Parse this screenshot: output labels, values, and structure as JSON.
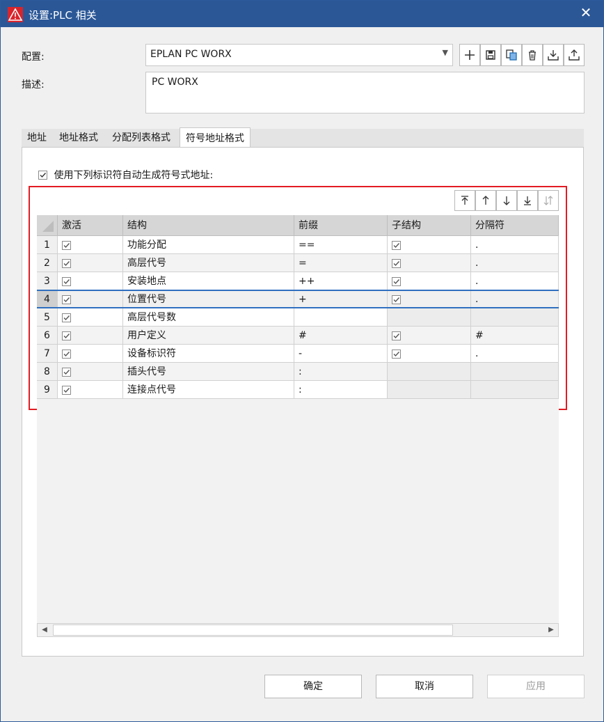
{
  "window": {
    "title": "设置:PLC 相关",
    "close_glyph": "✕"
  },
  "form": {
    "config_label": "配置:",
    "config_value": "EPLAN PC WORX",
    "desc_label": "描述:",
    "desc_value": "PC WORX"
  },
  "tabs": [
    {
      "label": "地址"
    },
    {
      "label": "地址格式"
    },
    {
      "label": "分配列表格式"
    },
    {
      "label": "符号地址格式",
      "active": true
    }
  ],
  "autogen_label": "使用下列标识符自动生成符号式地址:",
  "columns": [
    "激活",
    "结构",
    "前缀",
    "子结构",
    "分隔符"
  ],
  "rows": [
    {
      "num": "1",
      "active": true,
      "structure": "功能分配",
      "prefix": "==",
      "sub": true,
      "sep": "."
    },
    {
      "num": "2",
      "active": true,
      "structure": "高层代号",
      "prefix": "=",
      "sub": true,
      "sep": "."
    },
    {
      "num": "3",
      "active": true,
      "structure": "安装地点",
      "prefix": "++",
      "sub": true,
      "sep": "."
    },
    {
      "num": "4",
      "active": true,
      "structure": "位置代号",
      "prefix": "+",
      "sub": true,
      "sep": ".",
      "selected": true
    },
    {
      "num": "5",
      "active": true,
      "structure": "高层代号数",
      "prefix": "",
      "sub": false,
      "sep": ""
    },
    {
      "num": "6",
      "active": true,
      "structure": "用户定义",
      "prefix": "#",
      "sub": true,
      "sep": "#"
    },
    {
      "num": "7",
      "active": true,
      "structure": "设备标识符",
      "prefix": "-",
      "sub": true,
      "sep": "."
    },
    {
      "num": "8",
      "active": true,
      "structure": "插头代号",
      "prefix": ":",
      "sub": false,
      "sep": ""
    },
    {
      "num": "9",
      "active": true,
      "structure": "连接点代号",
      "prefix": ":",
      "sub": false,
      "sep": ""
    }
  ],
  "buttons": {
    "ok": "确定",
    "cancel": "取消",
    "apply": "应用"
  },
  "colors": {
    "titlebar": "#2b5797",
    "highlight_box": "#e31b23",
    "selection": "#2f6fbf"
  }
}
